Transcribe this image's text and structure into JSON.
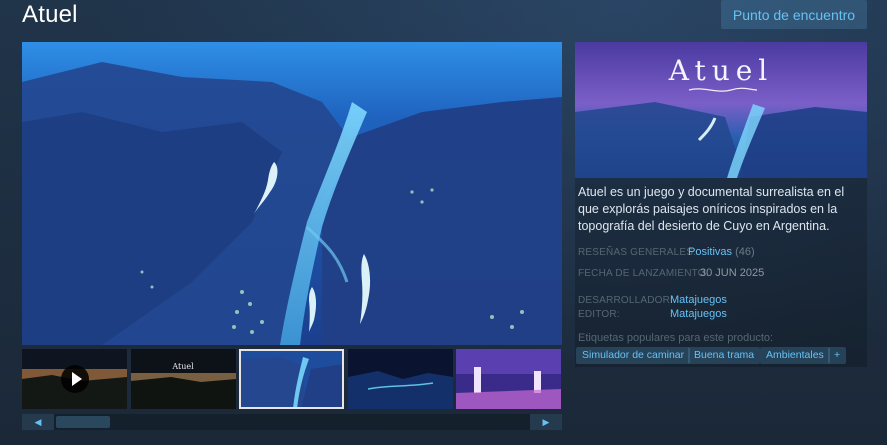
{
  "app": {
    "title": "Atuel",
    "community_hub_label": "Punto de encuentro"
  },
  "media": {
    "thumbnails": [
      {
        "kind": "video",
        "play_icon": "play-icon"
      },
      {
        "kind": "screenshot",
        "caption": "Atuel"
      },
      {
        "kind": "screenshot",
        "selected": true
      },
      {
        "kind": "screenshot"
      },
      {
        "kind": "screenshot"
      }
    ],
    "scroll_left_icon": "◀",
    "scroll_right_icon": "▶"
  },
  "info": {
    "header_title": "Atuel",
    "description": "Atuel es un juego y documental surrealista en el que explorás paisajes oníricos inspirados en la topografía del desierto de Cuyo en Argentina.",
    "reviews_label": "RESEÑAS GENERALES:",
    "reviews_value": "Positivas",
    "reviews_count": "(46)",
    "release_label": "FECHA DE LANZAMIENTO:",
    "release_value": "30 JUN 2025",
    "developer_label": "DESARROLLADOR:",
    "developer_value": "Matajuegos",
    "publisher_label": "EDITOR:",
    "publisher_value": "Matajuegos",
    "tags_label": "Etiquetas populares para este producto:",
    "tags": [
      "Simulador de caminar",
      "Buena trama",
      "Ambientales",
      "+"
    ]
  },
  "colors": {
    "background": "#1b2838",
    "accent": "#67c1f5",
    "text": "#c6d4df"
  }
}
